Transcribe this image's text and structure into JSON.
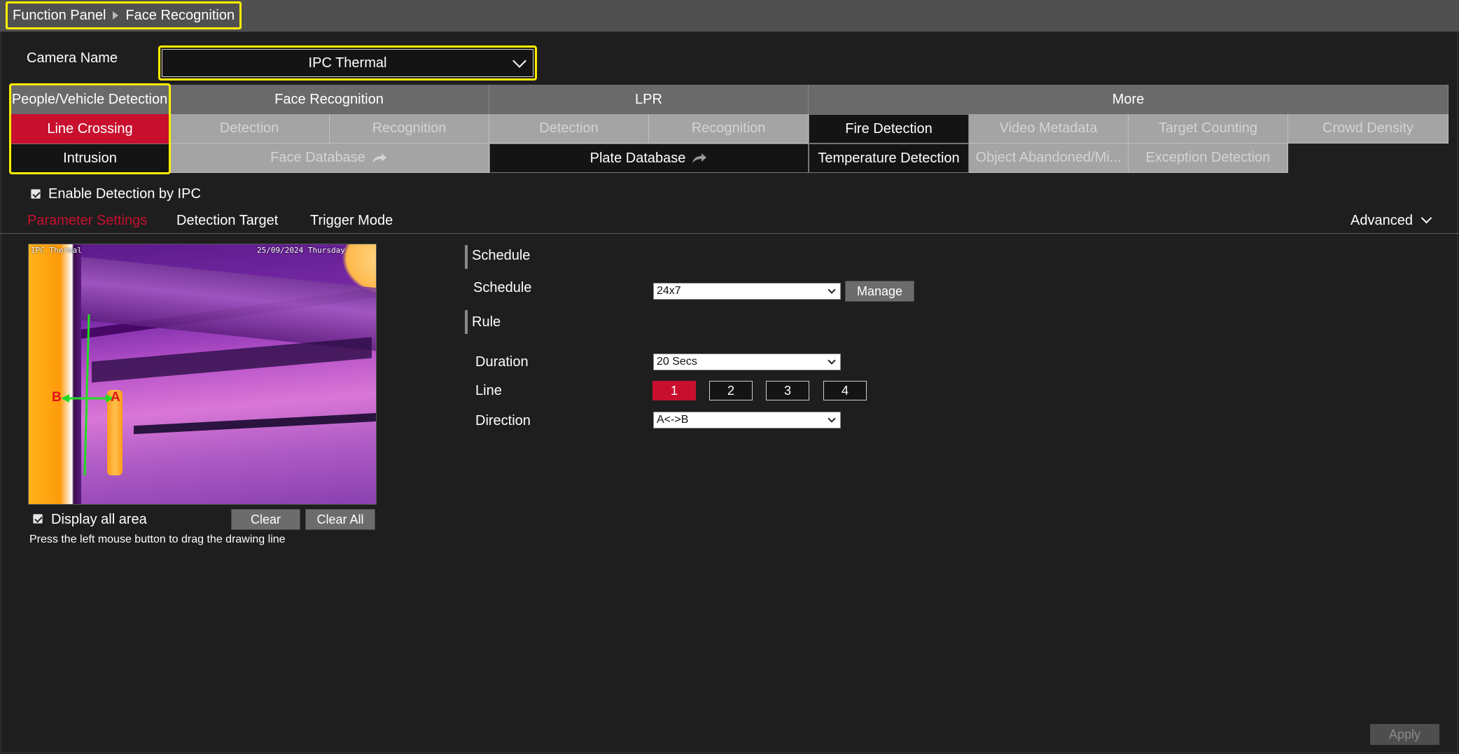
{
  "breadcrumb": {
    "root": "Function Panel",
    "current": "Face Recognition"
  },
  "camera": {
    "label": "Camera Name",
    "selected": "IPC Thermal"
  },
  "tab_groups": {
    "people_vehicle": {
      "header": "People/Vehicle Detection",
      "items": [
        "Line Crossing",
        "Intrusion"
      ]
    },
    "face": {
      "header": "Face Recognition",
      "items": [
        "Detection",
        "Recognition",
        "Face Database"
      ]
    },
    "lpr": {
      "header": "LPR",
      "items": [
        "Detection",
        "Recognition",
        "Plate Database"
      ]
    },
    "more": {
      "header": "More",
      "items": [
        "Fire Detection",
        "Video Metadata",
        "Target Counting",
        "Crowd Density",
        "Temperature Detection",
        "Object Abandoned/Mi...",
        "Exception Detection"
      ]
    }
  },
  "enable_detection": {
    "label": "Enable Detection by IPC",
    "checked": true
  },
  "subtabs": {
    "items": [
      "Parameter Settings",
      "Detection Target",
      "Trigger Mode"
    ],
    "active": "Parameter Settings",
    "advanced": "Advanced"
  },
  "preview": {
    "osd_left": "IPC Thermal",
    "osd_right": "25/09/2024 Thursday",
    "label_a": "A",
    "label_b": "B",
    "display_all": {
      "label": "Display all area",
      "checked": true
    },
    "clear": "Clear",
    "clear_all": "Clear All",
    "hint": "Press the left mouse button to drag the drawing line"
  },
  "schedule": {
    "section": "Schedule",
    "label": "Schedule",
    "value": "24x7",
    "manage": "Manage"
  },
  "rule": {
    "section": "Rule",
    "duration": {
      "label": "Duration",
      "value": "20 Secs"
    },
    "line": {
      "label": "Line",
      "options": [
        "1",
        "2",
        "3",
        "4"
      ],
      "selected": "1"
    },
    "direction": {
      "label": "Direction",
      "value": "A<->B"
    }
  },
  "apply": "Apply",
  "colors": {
    "accent": "#c8102e",
    "highlight": "#ffee00",
    "line": "#22dd22"
  }
}
